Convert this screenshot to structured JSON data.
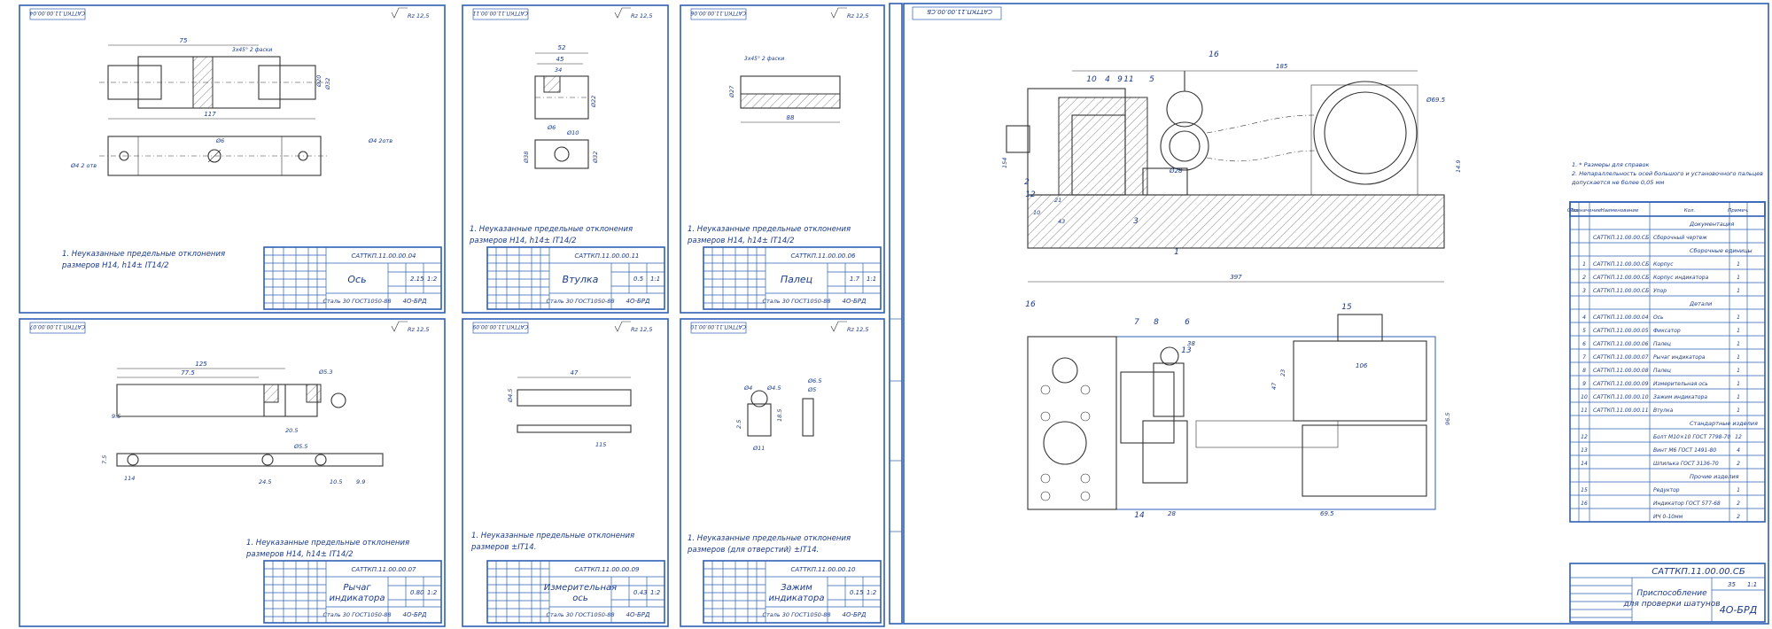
{
  "roughness": "Rz 12,5",
  "notes": {
    "tol_a": "1. Неуказанные предельные отклонения",
    "tol_b": "размеров H14, h14±",
    "tol_frac": "IT14/2",
    "tol_c": "размеров ±IT14.",
    "tol_d": "размеров (для отверстий) ±IT14."
  },
  "standard_material": "Сталь 30 ГОСТ1050-88",
  "group": "4О-БРД",
  "sheets": [
    {
      "code": "САТТКП.11.00.00.04",
      "name": "Ось",
      "mass": "2.15",
      "scale": "1:2"
    },
    {
      "code": "САТТКП.11.00.00.11",
      "name": "Втулка",
      "mass": "0.5",
      "scale": "1:1"
    },
    {
      "code": "САТТКП.11.00.00.06",
      "name": "Палец",
      "mass": "1.7",
      "scale": "1:1"
    },
    {
      "code": "САТТКП.11.00.00.07",
      "name": "Рычаг индикатора",
      "mass": "0.80",
      "scale": "1:2"
    },
    {
      "code": "САТТКП.11.00.00.09",
      "name": "Измерительная ось",
      "mass": "0.43",
      "scale": "1:2"
    },
    {
      "code": "САТТКП.11.00.00.10",
      "name": "Зажим индикатора",
      "mass": "0.15",
      "scale": "1:2"
    }
  ],
  "dims": {
    "axis": [
      "75",
      "117",
      "3x45° 2 фаски",
      "Ø32",
      "Ø20",
      "Ø6",
      "Ø4 2 отв",
      "Ø4 2отв"
    ],
    "bush": [
      "52",
      "45",
      "34",
      "Ø6",
      "Ø10",
      "Ø38",
      "Ø32",
      "Ø22"
    ],
    "pin": [
      "3x45° 2 фаски",
      "88",
      "Ø27"
    ],
    "lever": [
      "125",
      "77.5",
      "20.5",
      "Ø5.5",
      "Ø5.3",
      "114",
      "24.5",
      "10.5",
      "9.9",
      "7.5",
      "9.5"
    ],
    "meas": [
      "47",
      "Ø4.5",
      "115"
    ],
    "clamp": [
      "Ø4",
      "Ø4.5",
      "Ø6.5",
      "Ø5",
      "18.5",
      "Ø11",
      "2.5"
    ],
    "assembly": [
      "185",
      "Ø69.5",
      "Ø28",
      "154",
      "397",
      "10",
      "43",
      "21",
      "38",
      "106",
      "23",
      "47",
      "69.5",
      "28",
      "96.5",
      "14.9"
    ]
  },
  "assembly": {
    "code": "САТТКП.11.00.00.СБ",
    "name": "Приспособление для проверки шатунов",
    "group": "4О-БРД",
    "notes": [
      "1. * Размеры для справок",
      "2. Непараллельность осей большого и установочного пальцев",
      "допускается не более 0,05 мм"
    ],
    "balloons": [
      "1",
      "2",
      "3",
      "4",
      "5",
      "6",
      "7",
      "8",
      "9",
      "10",
      "11",
      "12",
      "13",
      "14",
      "15",
      "16"
    ],
    "bom_header": [
      "Поз.",
      "Обозначение",
      "Наименование",
      "Кол.",
      "Примеч."
    ],
    "bom": [
      {
        "sec": "Документация"
      },
      {
        "pos": "",
        "code": "САТТКП.11.00.00.СБ",
        "name": "Сборочный чертеж",
        "qty": ""
      },
      {
        "sec": "Сборочные единицы"
      },
      {
        "pos": "1",
        "code": "САТТКП.11.00.00.СБ",
        "name": "Корпус",
        "qty": "1"
      },
      {
        "pos": "2",
        "code": "САТТКП.11.00.00.СБ",
        "name": "Корпус индикатора",
        "qty": "1"
      },
      {
        "pos": "3",
        "code": "САТТКП.11.00.00.СБ",
        "name": "Упор",
        "qty": "1"
      },
      {
        "sec": "Детали"
      },
      {
        "pos": "4",
        "code": "САТТКП.11.00.00.04",
        "name": "Ось",
        "qty": "1"
      },
      {
        "pos": "5",
        "code": "САТТКП.11.00.00.05",
        "name": "Фиксатор",
        "qty": "1"
      },
      {
        "pos": "6",
        "code": "САТТКП.11.00.00.06",
        "name": "Палец",
        "qty": "1"
      },
      {
        "pos": "7",
        "code": "САТТКП.11.00.00.07",
        "name": "Рычаг индикатора",
        "qty": "1"
      },
      {
        "pos": "8",
        "code": "САТТКП.11.00.00.08",
        "name": "Палец",
        "qty": "1"
      },
      {
        "pos": "9",
        "code": "САТТКП.11.00.00.09",
        "name": "Измерительная ось",
        "qty": "1"
      },
      {
        "pos": "10",
        "code": "САТТКП.11.00.00.10",
        "name": "Зажим индикатора",
        "qty": "1"
      },
      {
        "pos": "11",
        "code": "САТТКП.11.00.00.11",
        "name": "Втулка",
        "qty": "1"
      },
      {
        "sec": "Стандартные изделия"
      },
      {
        "pos": "12",
        "code": "",
        "name": "Болт М10×10 ГОСТ 7798-70",
        "qty": "12"
      },
      {
        "pos": "13",
        "code": "",
        "name": "Винт М6 ГОСТ 1491-80",
        "qty": "4"
      },
      {
        "pos": "14",
        "code": "",
        "name": "Шпилька ГОСТ 3136-70",
        "qty": "2"
      },
      {
        "sec": "Прочие изделия"
      },
      {
        "pos": "15",
        "code": "",
        "name": "Редуктор",
        "qty": "1"
      },
      {
        "pos": "16",
        "code": "",
        "name": "Индикатор ГОСТ 577-68",
        "qty": "2"
      },
      {
        "pos": "",
        "code": "",
        "name": "ИЧ 0-10мм",
        "qty": "2"
      }
    ],
    "title_mass": "35",
    "title_scale": "1:1"
  }
}
